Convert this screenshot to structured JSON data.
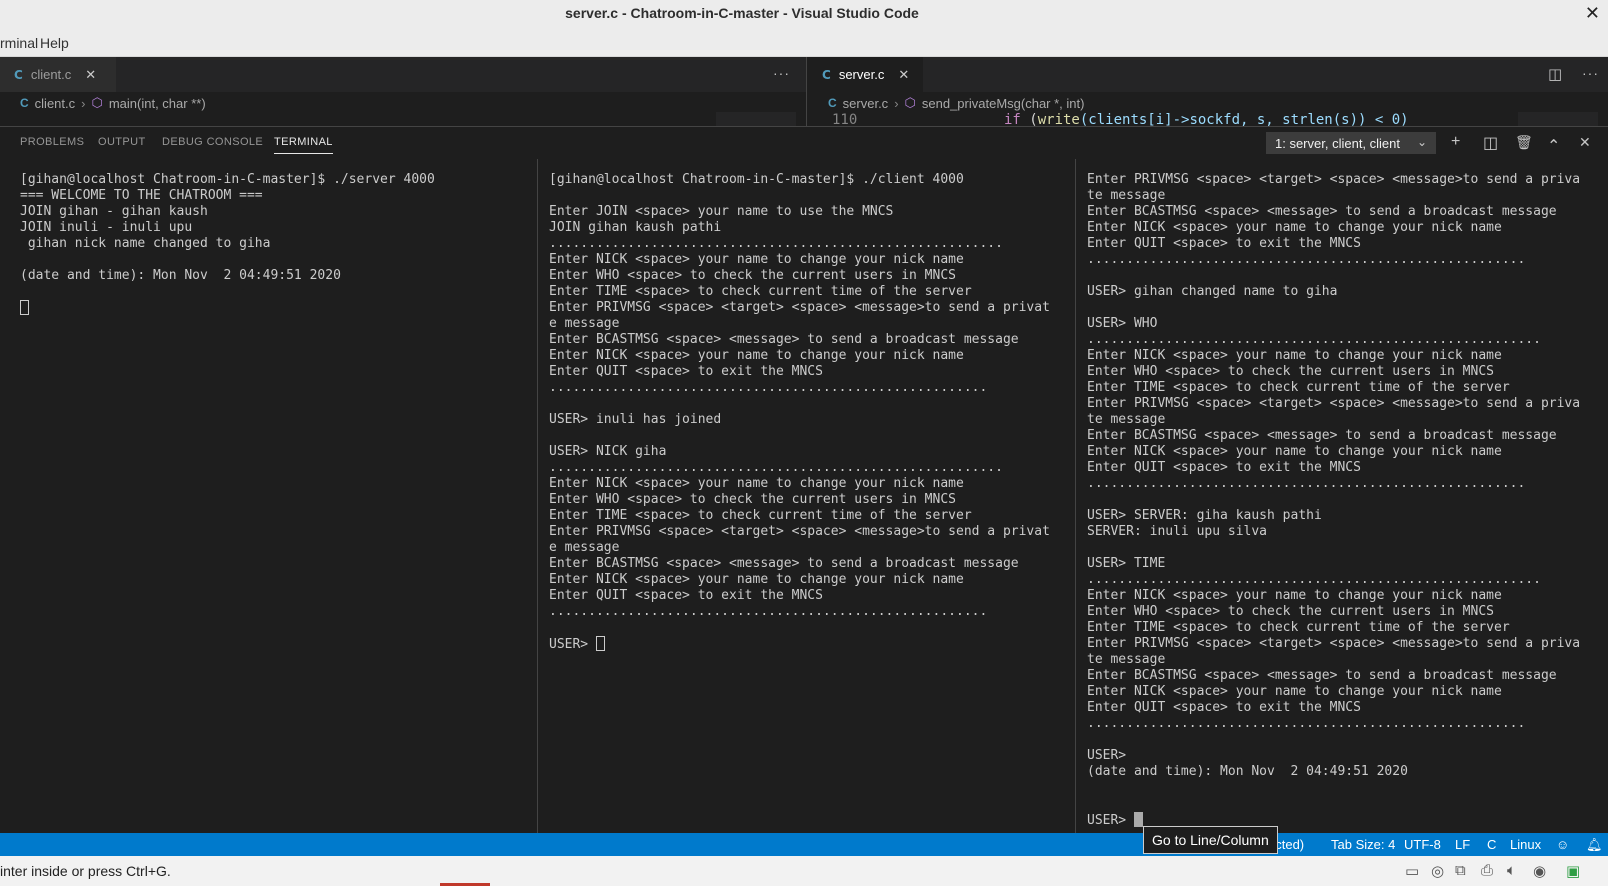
{
  "window": {
    "title": "server.c - Chatroom-in-C-master - Visual Studio Code",
    "close": "✕"
  },
  "menu": {
    "items": [
      "rminal",
      "Help"
    ]
  },
  "editor_left": {
    "tab": {
      "icon": "C",
      "label": "client.c",
      "close": "✕"
    },
    "more": "···",
    "breadcrumb": {
      "icon": "C",
      "file": "client.c",
      "sep": "›",
      "symbol_icon": "⬡",
      "symbol": "main(int, char **)"
    }
  },
  "editor_right": {
    "tab": {
      "icon": "C",
      "label": "server.c",
      "close": "✕"
    },
    "breadcrumb": {
      "icon": "C",
      "file": "server.c",
      "sep": "›",
      "symbol_icon": "⬡",
      "symbol": "send_privateMsg(char *, int)"
    },
    "code_line": {
      "number": "110",
      "kw": "if",
      "open": " (",
      "fn": "write",
      "args": "(clients[i]->sockfd, s, strlen(s)) < 0)"
    }
  },
  "panel": {
    "tabs": [
      "PROBLEMS",
      "OUTPUT",
      "DEBUG CONSOLE",
      "TERMINAL"
    ],
    "terminal_select": "1: server, client, client",
    "icons": {
      "plus": "+",
      "split": "◫",
      "trash": "🗑",
      "up": "⌃",
      "close": "✕"
    }
  },
  "terminals": {
    "server": [
      "[gihan@localhost Chatroom-in-C-master]$ ./server 4000",
      "=== WELCOME TO THE CHATROOM ===",
      "JOIN gihan - gihan kaush",
      "JOIN inuli - inuli upu",
      " gihan nick name changed to giha",
      "",
      "(date and time): Mon Nov  2 04:49:51 2020",
      ""
    ],
    "client1": [
      "[gihan@localhost Chatroom-in-C-master]$ ./client 4000",
      "",
      "Enter JOIN <space> your name to use the MNCS",
      "JOIN gihan kaush pathi",
      "..........................................................",
      "Enter NICK <space> your name to change your nick name",
      "Enter WHO <space> to check the current users in MNCS",
      "Enter TIME <space> to check current time of the server",
      "Enter PRIVMSG <space> <target> <space> <message>to send a privat",
      "e message",
      "Enter BCASTMSG <space> <message> to send a broadcast message",
      "Enter NICK <space> your name to change your nick name",
      "Enter QUIT <space> to exit the MNCS",
      "........................................................",
      "",
      "USER> inuli has joined",
      "",
      "USER> NICK giha",
      "..........................................................",
      "Enter NICK <space> your name to change your nick name",
      "Enter WHO <space> to check the current users in MNCS",
      "Enter TIME <space> to check current time of the server",
      "Enter PRIVMSG <space> <target> <space> <message>to send a privat",
      "e message",
      "Enter BCASTMSG <space> <message> to send a broadcast message",
      "Enter NICK <space> your name to change your nick name",
      "Enter QUIT <space> to exit the MNCS",
      "........................................................",
      ""
    ],
    "client1_prompt": "USER> ",
    "client2": [
      "Enter PRIVMSG <space> <target> <space> <message>to send a priva",
      "te message",
      "Enter BCASTMSG <space> <message> to send a broadcast message",
      "Enter NICK <space> your name to change your nick name",
      "Enter QUIT <space> to exit the MNCS",
      "........................................................",
      "",
      "USER> gihan changed name to giha",
      "",
      "USER> WHO",
      "..........................................................",
      "Enter NICK <space> your name to change your nick name",
      "Enter WHO <space> to check the current users in MNCS",
      "Enter TIME <space> to check current time of the server",
      "Enter PRIVMSG <space> <target> <space> <message>to send a priva",
      "te message",
      "Enter BCASTMSG <space> <message> to send a broadcast message",
      "Enter NICK <space> your name to change your nick name",
      "Enter QUIT <space> to exit the MNCS",
      "........................................................",
      "",
      "USER> SERVER: giha kaush pathi",
      "SERVER: inuli upu silva",
      "",
      "USER> TIME",
      "..........................................................",
      "Enter NICK <space> your name to change your nick name",
      "Enter WHO <space> to check the current users in MNCS",
      "Enter TIME <space> to check current time of the server",
      "Enter PRIVMSG <space> <target> <space> <message>to send a priva",
      "te message",
      "Enter BCASTMSG <space> <message> to send a broadcast message",
      "Enter NICK <space> your name to change your nick name",
      "Enter QUIT <space> to exit the MNCS",
      "........................................................",
      "",
      "USER>",
      "(date and time): Mon Nov  2 04:49:51 2020",
      "",
      ""
    ],
    "client2_prompt": "USER> "
  },
  "statusbar": {
    "fragment": "ected)",
    "tab_size": "Tab Size: 4",
    "encoding": "UTF-8",
    "eol": "LF",
    "language": "C",
    "platform": "Linux"
  },
  "tooltip": "Go to Line/Column",
  "hint": "inter inside or press Ctrl+G."
}
